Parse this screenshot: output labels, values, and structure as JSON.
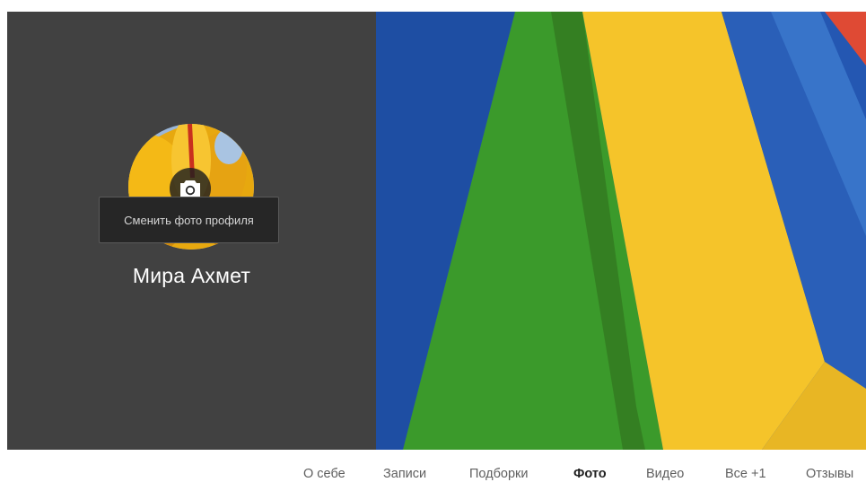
{
  "profile": {
    "name": "Мира Ахмет",
    "change_photo_tooltip": "Сменить фото профиля"
  },
  "icons": {
    "camera": "camera-icon",
    "avatar": "yellow-flower-photo"
  },
  "colors": {
    "panel_background": "#414141",
    "tooltip_background": "#262626",
    "cover_blue": "#2056b0",
    "cover_green": "#3c9b2c",
    "cover_yellow": "#f6c52b",
    "cover_red": "#e04a35"
  },
  "tabs": [
    {
      "label": "О себе",
      "active": false
    },
    {
      "label": "Записи",
      "active": false
    },
    {
      "label": "Подборки",
      "active": false
    },
    {
      "label": "Фото",
      "active": true
    },
    {
      "label": "Видео",
      "active": false
    },
    {
      "label": "Все +1",
      "active": false
    },
    {
      "label": "Отзывы",
      "active": false
    }
  ]
}
